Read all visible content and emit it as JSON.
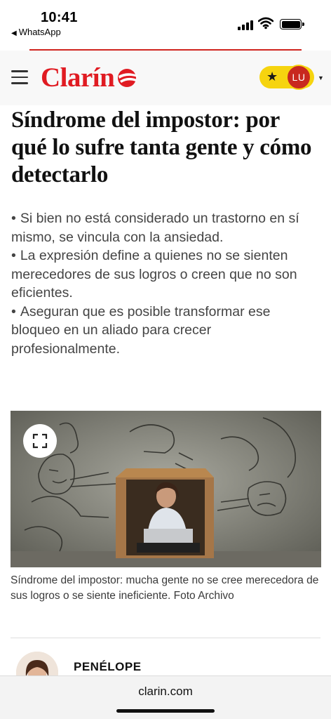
{
  "status_bar": {
    "time": "10:41",
    "back_app": "WhatsApp"
  },
  "reading_progress": 1.0,
  "header": {
    "logo_text": "Clarín",
    "user_initials": "LU",
    "accent_color": "#e01b22",
    "pill_color": "#f6d40f"
  },
  "article": {
    "headline": "Síndrome del impostor: por qué lo sufre tanta gente y cómo detectarlo",
    "bullet_char": "•",
    "summary": [
      "Si bien no está considerado un trastorno en sí mismo, se vincula con la ansiedad.",
      "La expresión define a quienes no se sienten merecedores de sus logros o creen que no son eficientes.",
      "Aseguran que es posible transformar ese bloqueo en un aliado para crecer profesionalmente."
    ],
    "image_caption": "Síndrome del impostor: mucha gente no se cree merecedora de sus logros o se siente ineficiente. Foto Archivo",
    "author_name": "PENÉLOPE"
  },
  "browser": {
    "url": "clarin.com"
  }
}
